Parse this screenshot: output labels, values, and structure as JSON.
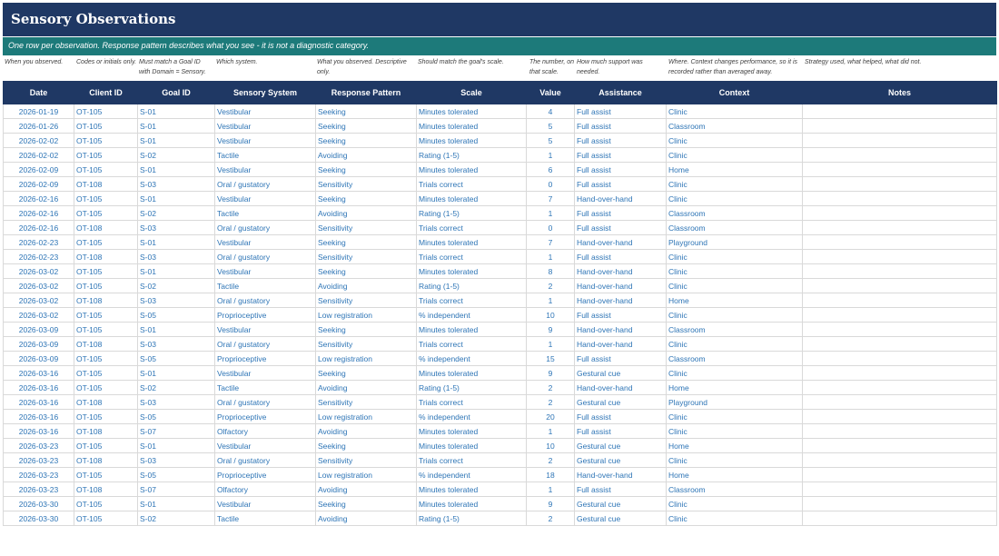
{
  "title": "Sensory Observations",
  "subtitle": "One row per observation. Response pattern describes what you see - it is not a diagnostic category.",
  "hints": [
    "When you observed.",
    "Codes or initials only.",
    "Must match a Goal ID\nwith Domain = Sensory.",
    "Which system.",
    "What you observed. Descriptive\nonly.",
    "Should match the goal's scale.",
    "The number, on\nthat scale.",
    "How much support was\nneeded.",
    "Where. Context changes performance, so it is\nrecorded rather than averaged away.",
    "Strategy used, what helped, what did not."
  ],
  "columns": [
    "Date",
    "Client ID",
    "Goal ID",
    "Sensory System",
    "Response Pattern",
    "Scale",
    "Value",
    "Assistance",
    "Context",
    "Notes"
  ],
  "rows": [
    [
      "2026-01-19",
      "OT-105",
      "S-01",
      "Vestibular",
      "Seeking",
      "Minutes tolerated",
      "4",
      "Full assist",
      "Clinic",
      ""
    ],
    [
      "2026-01-26",
      "OT-105",
      "S-01",
      "Vestibular",
      "Seeking",
      "Minutes tolerated",
      "5",
      "Full assist",
      "Classroom",
      ""
    ],
    [
      "2026-02-02",
      "OT-105",
      "S-01",
      "Vestibular",
      "Seeking",
      "Minutes tolerated",
      "5",
      "Full assist",
      "Clinic",
      ""
    ],
    [
      "2026-02-02",
      "OT-105",
      "S-02",
      "Tactile",
      "Avoiding",
      "Rating (1-5)",
      "1",
      "Full assist",
      "Clinic",
      ""
    ],
    [
      "2026-02-09",
      "OT-105",
      "S-01",
      "Vestibular",
      "Seeking",
      "Minutes tolerated",
      "6",
      "Full assist",
      "Home",
      ""
    ],
    [
      "2026-02-09",
      "OT-108",
      "S-03",
      "Oral / gustatory",
      "Sensitivity",
      "Trials correct",
      "0",
      "Full assist",
      "Clinic",
      ""
    ],
    [
      "2026-02-16",
      "OT-105",
      "S-01",
      "Vestibular",
      "Seeking",
      "Minutes tolerated",
      "7",
      "Hand-over-hand",
      "Clinic",
      ""
    ],
    [
      "2026-02-16",
      "OT-105",
      "S-02",
      "Tactile",
      "Avoiding",
      "Rating (1-5)",
      "1",
      "Full assist",
      "Classroom",
      ""
    ],
    [
      "2026-02-16",
      "OT-108",
      "S-03",
      "Oral / gustatory",
      "Sensitivity",
      "Trials correct",
      "0",
      "Full assist",
      "Classroom",
      ""
    ],
    [
      "2026-02-23",
      "OT-105",
      "S-01",
      "Vestibular",
      "Seeking",
      "Minutes tolerated",
      "7",
      "Hand-over-hand",
      "Playground",
      ""
    ],
    [
      "2026-02-23",
      "OT-108",
      "S-03",
      "Oral / gustatory",
      "Sensitivity",
      "Trials correct",
      "1",
      "Full assist",
      "Clinic",
      ""
    ],
    [
      "2026-03-02",
      "OT-105",
      "S-01",
      "Vestibular",
      "Seeking",
      "Minutes tolerated",
      "8",
      "Hand-over-hand",
      "Clinic",
      ""
    ],
    [
      "2026-03-02",
      "OT-105",
      "S-02",
      "Tactile",
      "Avoiding",
      "Rating (1-5)",
      "2",
      "Hand-over-hand",
      "Clinic",
      ""
    ],
    [
      "2026-03-02",
      "OT-108",
      "S-03",
      "Oral / gustatory",
      "Sensitivity",
      "Trials correct",
      "1",
      "Hand-over-hand",
      "Home",
      ""
    ],
    [
      "2026-03-02",
      "OT-105",
      "S-05",
      "Proprioceptive",
      "Low registration",
      "% independent",
      "10",
      "Full assist",
      "Clinic",
      ""
    ],
    [
      "2026-03-09",
      "OT-105",
      "S-01",
      "Vestibular",
      "Seeking",
      "Minutes tolerated",
      "9",
      "Hand-over-hand",
      "Classroom",
      ""
    ],
    [
      "2026-03-09",
      "OT-108",
      "S-03",
      "Oral / gustatory",
      "Sensitivity",
      "Trials correct",
      "1",
      "Hand-over-hand",
      "Clinic",
      ""
    ],
    [
      "2026-03-09",
      "OT-105",
      "S-05",
      "Proprioceptive",
      "Low registration",
      "% independent",
      "15",
      "Full assist",
      "Classroom",
      ""
    ],
    [
      "2026-03-16",
      "OT-105",
      "S-01",
      "Vestibular",
      "Seeking",
      "Minutes tolerated",
      "9",
      "Gestural cue",
      "Clinic",
      ""
    ],
    [
      "2026-03-16",
      "OT-105",
      "S-02",
      "Tactile",
      "Avoiding",
      "Rating (1-5)",
      "2",
      "Hand-over-hand",
      "Home",
      ""
    ],
    [
      "2026-03-16",
      "OT-108",
      "S-03",
      "Oral / gustatory",
      "Sensitivity",
      "Trials correct",
      "2",
      "Gestural cue",
      "Playground",
      ""
    ],
    [
      "2026-03-16",
      "OT-105",
      "S-05",
      "Proprioceptive",
      "Low registration",
      "% independent",
      "20",
      "Full assist",
      "Clinic",
      ""
    ],
    [
      "2026-03-16",
      "OT-108",
      "S-07",
      "Olfactory",
      "Avoiding",
      "Minutes tolerated",
      "1",
      "Full assist",
      "Clinic",
      ""
    ],
    [
      "2026-03-23",
      "OT-105",
      "S-01",
      "Vestibular",
      "Seeking",
      "Minutes tolerated",
      "10",
      "Gestural cue",
      "Home",
      ""
    ],
    [
      "2026-03-23",
      "OT-108",
      "S-03",
      "Oral / gustatory",
      "Sensitivity",
      "Trials correct",
      "2",
      "Gestural cue",
      "Clinic",
      ""
    ],
    [
      "2026-03-23",
      "OT-105",
      "S-05",
      "Proprioceptive",
      "Low registration",
      "% independent",
      "18",
      "Hand-over-hand",
      "Home",
      ""
    ],
    [
      "2026-03-23",
      "OT-108",
      "S-07",
      "Olfactory",
      "Avoiding",
      "Minutes tolerated",
      "1",
      "Full assist",
      "Classroom",
      ""
    ],
    [
      "2026-03-30",
      "OT-105",
      "S-01",
      "Vestibular",
      "Seeking",
      "Minutes tolerated",
      "9",
      "Gestural cue",
      "Clinic",
      ""
    ],
    [
      "2026-03-30",
      "OT-105",
      "S-02",
      "Tactile",
      "Avoiding",
      "Rating (1-5)",
      "2",
      "Gestural cue",
      "Clinic",
      ""
    ]
  ]
}
